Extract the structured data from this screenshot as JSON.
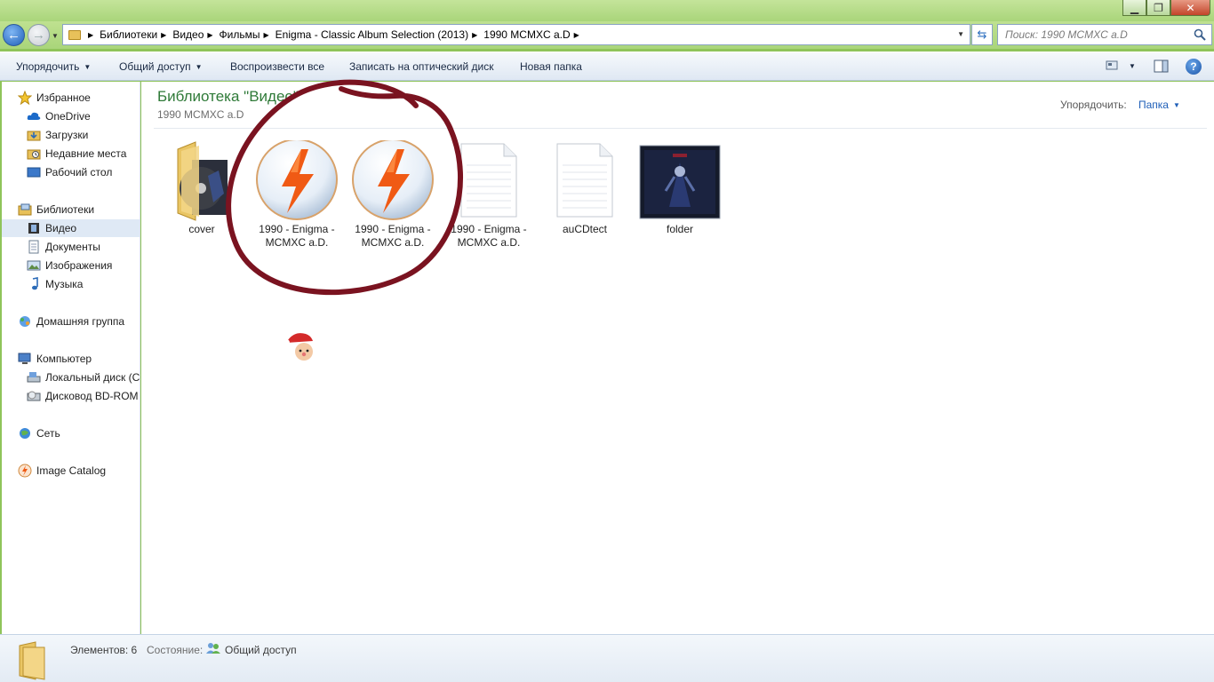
{
  "window": {
    "close_glyph": "✕",
    "maximize_glyph": "❐",
    "minimize_glyph": "▁"
  },
  "address": {
    "breadcrumbs": [
      "Библиотеки",
      "Видео",
      "Фильмы",
      "Enigma - Classic Album Selection (2013)",
      "1990 MCMXC a.D"
    ],
    "search_placeholder": "Поиск: 1990 MCMXC a.D"
  },
  "toolbar": {
    "organize": "Упорядочить",
    "share": "Общий доступ",
    "play_all": "Воспроизвести все",
    "burn": "Записать на оптический диск",
    "new_folder": "Новая папка",
    "help": "?"
  },
  "sidebar": {
    "favorites": "Избранное",
    "onedrive": "OneDrive",
    "downloads": "Загрузки",
    "recent": "Недавние места",
    "desktop": "Рабочий стол",
    "libraries": "Библиотеки",
    "video": "Видео",
    "documents": "Документы",
    "pictures": "Изображения",
    "music": "Музыка",
    "homegroup": "Домашняя группа",
    "computer": "Компьютер",
    "local_disk": "Локальный диск (C",
    "bd_rom": "Дисковод BD-ROM",
    "network": "Сеть",
    "image_catalog": "Image Catalog"
  },
  "content": {
    "library_title": "Библиотека \"Видео\"",
    "folder_subtitle": "1990 MCMXC a.D",
    "arrange_label": "Упорядочить:",
    "arrange_value": "Папка",
    "files": [
      {
        "name": "cover",
        "icon": "folder-with-cd-icon"
      },
      {
        "name": "1990 - Enigma - MCMXC a.D.",
        "icon": "lightning-app-icon"
      },
      {
        "name": "1990 - Enigma - MCMXC a.D.",
        "icon": "lightning-app-icon"
      },
      {
        "name": "1990 - Enigma - MCMXC a.D.",
        "icon": "text-document-icon"
      },
      {
        "name": "auCDtect",
        "icon": "text-document-icon"
      },
      {
        "name": "folder",
        "icon": "album-cover-image-icon"
      }
    ]
  },
  "status": {
    "item_count": "Элементов: 6",
    "state_label": "Состояние:",
    "state_value": "Общий доступ"
  },
  "colors": {
    "window_frame": "#a9d57a",
    "library_title": "#2f7a38",
    "link_blue": "#1f5fb8",
    "selection": "#dfe9f5",
    "annotation_circle": "#7a1320"
  }
}
